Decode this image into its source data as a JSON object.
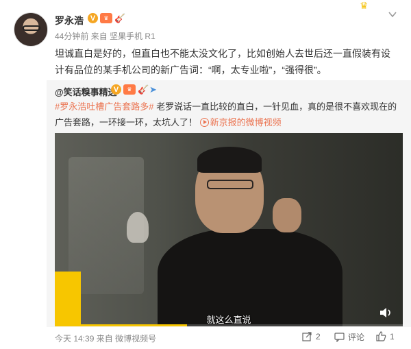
{
  "post": {
    "author": "罗永浩",
    "meta_time": "44分钟前",
    "meta_from_prefix": "来自",
    "meta_device": "坚果手机 R1",
    "content": "坦诚直白是好的，但直白也不能太没文化了，比如创始人去世后还一直假装有设计有品位的某手机公司的新广告词：“啊，太专业啦”，“强得很”。",
    "badges": [
      "verified-icon",
      "level-icon",
      "guitar-icon"
    ]
  },
  "retweet": {
    "author": "@笑话糗事精选",
    "topic": "#罗永浩吐槽广告套路多#",
    "text": " 老罗说话一直比较的直白，一针见血，真的是很不喜欢现在的广告套路，一环接一环，太坑人了！",
    "video_link": "新京报的微博视频",
    "video": {
      "subtitle": "就这么直说",
      "progress": 0.38
    }
  },
  "footer": {
    "time": "今天 14:39",
    "from_prefix": "来自",
    "source": "微博视频号",
    "share_count": "2",
    "comment_label": "评论",
    "like_count": "1"
  },
  "colors": {
    "link": "#eb7350",
    "accent_yellow": "#f7c600",
    "muted": "#888888"
  }
}
